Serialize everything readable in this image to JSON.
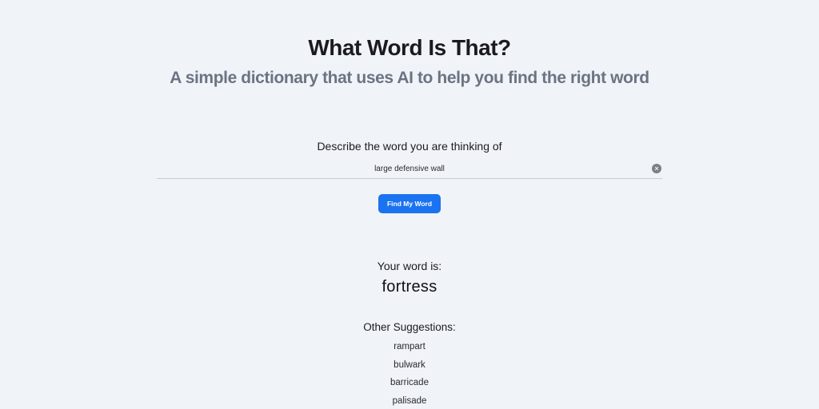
{
  "header": {
    "title": "What Word Is That?",
    "subtitle": "A simple dictionary that uses AI to help you find the right word"
  },
  "search": {
    "label": "Describe the word you are thinking of",
    "value": "large defensive wall",
    "clear_symbol": "×",
    "button_label": "Find My Word"
  },
  "result": {
    "label": "Your word is:",
    "word": "fortress",
    "other_label": "Other Suggestions:",
    "suggestions": [
      "rampart",
      "bulwark",
      "barricade",
      "palisade"
    ]
  },
  "colors": {
    "background": "#f0f3f8",
    "accent": "#1a73f0",
    "subtitle": "#6b7482"
  }
}
